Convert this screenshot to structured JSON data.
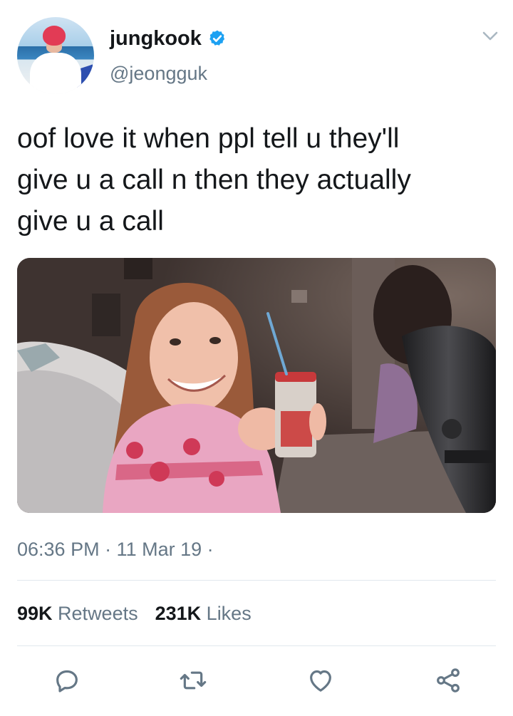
{
  "user": {
    "name": "jungkook",
    "handle": "@jeongguk",
    "verified": true
  },
  "tweet": {
    "lines": [
      "oof love it when ppl tell u they'll",
      "give u a call n then they actually",
      "give u a call"
    ],
    "timestamp": "06:36 PM · 11 Mar 19 ·"
  },
  "stats": {
    "retweets_count": "99K",
    "retweets_label": "Retweets",
    "likes_count": "231K",
    "likes_label": "Likes"
  },
  "icons": {
    "reply": "reply-icon",
    "retweet": "retweet-icon",
    "like": "heart-icon",
    "share": "share-icon",
    "menu": "chevron-down-icon",
    "verified": "verified-badge-icon"
  },
  "colors": {
    "brand": "#1da1f2",
    "text": "#14171a",
    "secondary": "#657786",
    "divider": "#e1e8ed"
  }
}
